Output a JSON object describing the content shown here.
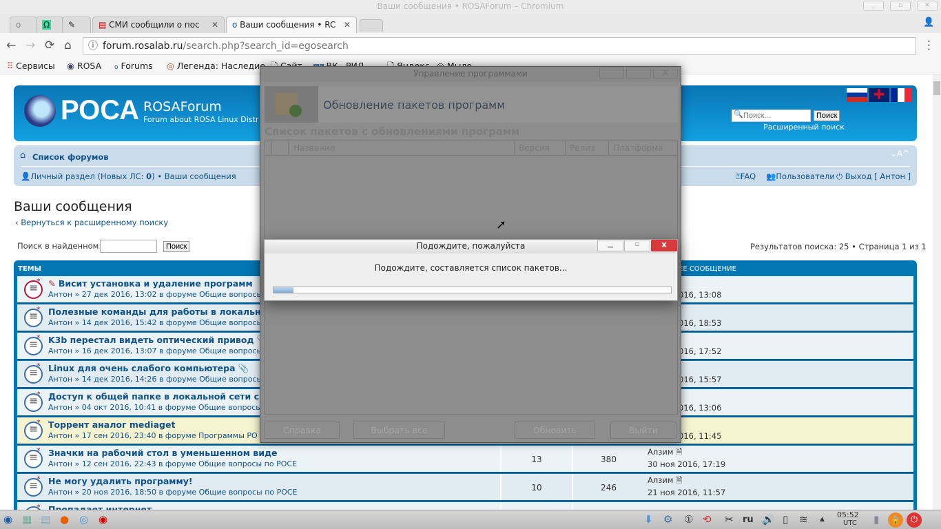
{
  "window": {
    "title": "Ваши сообщения • ROSAForum – Chromium"
  },
  "tabs": [
    {
      "label": "o"
    },
    {
      "label": ""
    },
    {
      "label": ""
    },
    {
      "label": "СМИ сообщили о пос"
    },
    {
      "label": "Ваши сообщения • RC",
      "active": true
    }
  ],
  "address": {
    "host": "forum.rosalab.ru",
    "path": "/search.php?search_id=egosearch"
  },
  "bookmarks": [
    "Сервисы",
    "ROSA",
    "Forums",
    "Легенда: Наследие",
    "Сайт",
    "ВК",
    "РИД",
    "Яндекс",
    "Мыло"
  ],
  "forum": {
    "logo_text": "РОСА",
    "site_name": "ROSAForum",
    "site_desc": "Forum about ROSA Linux Distr",
    "search_placeholder": "Поиск...",
    "search_button": "Поиск",
    "advanced_search": "Расширенный поиск",
    "breadcrumb": "Список форумов",
    "font_size_ctrl": "⌄A^",
    "personal": "Личный раздел (Новых ЛС: ",
    "new_pm": "0",
    "personal_end": ")",
    "sep": " • ",
    "your_posts": "Ваши сообщения",
    "faq": "FAQ",
    "users": "Пользователи",
    "logout": "Выход [ Антон ]",
    "page_title": "Ваши сообщения",
    "back_link": "Вернуться к расширенному поиску",
    "search_in_found": "Поиск в найденном:",
    "search_in_found_button": "Поиск",
    "results": "Результатов поиска: 25 • Страница 1 из 1",
    "col_topics": "ТЕМЫ",
    "col_last": "ЕЕ СООБЩЕНИЕ",
    "rows": [
      {
        "title": "Висит установка и удаление программ",
        "meta": "Антон » 27 дек 2016, 13:02 в форуме Общие вопросы",
        "last": "016, 13:08",
        "hot": true
      },
      {
        "title": "Полезные команды для работы в локальной сет",
        "meta": "Антон » 14 дек 2016, 15:42 в форуме Общие вопросы",
        "last": "016, 18:53"
      },
      {
        "title": "K3b перестал видеть оптический привод",
        "meta": "Антон » 16 дек 2016, 13:07 в форуме Общие вопросы",
        "last": "016, 17:52",
        "attach": true
      },
      {
        "title": "Linux для очень слабого компьютера",
        "meta": "Антон » 14 дек 2016, 14:26 в форуме Общие вопросы",
        "last": "016, 15:57",
        "attach": true
      },
      {
        "title": "Доступ к общей папке в локальной сети с домен",
        "meta": "Антон » 04 окт 2016, 10:41 в форуме Общие вопросы",
        "last": "016, 13:06"
      },
      {
        "title": "Торрент аналог mediaget",
        "meta": "Антон » 17 сен 2016, 23:40 в форуме Программы РО",
        "last": "016, 11:45",
        "highlight": true
      },
      {
        "title": "Значки на рабочий стол в уменьшенном виде",
        "meta": "Антон » 12 сен 2016, 22:43 в форуме Общие вопросы по РОСЕ",
        "replies": "13",
        "views": "380",
        "last_author": "Алзим",
        "last": "30 ноя 2016, 17:19"
      },
      {
        "title": "Не могу удалить программу!",
        "meta": "Антон » 20 ноя 2016, 18:50 в форуме Общие вопросы по РОСЕ",
        "replies": "10",
        "views": "246",
        "last_author": "Алзим",
        "last": "21 ноя 2016, 11:57"
      },
      {
        "title": "Пропадает интернет",
        "meta": "",
        "last": ""
      }
    ]
  },
  "app": {
    "title": "Управление программами",
    "header": "Обновление пакетов программ",
    "section": "Список пакетов с обновлениями программ",
    "columns": [
      "Название",
      "Версия",
      "Релиз",
      "Платформа"
    ],
    "buttons": [
      "Справка",
      "Выбрать все",
      "Обновить",
      "Выйти"
    ]
  },
  "wait": {
    "title": "Подождите, пожалуйста",
    "message": "Подождите, составляется список пакетов...",
    "progress_percent": 5
  },
  "tray": {
    "lang": "ru",
    "time": "05:52",
    "tz": "UTC"
  }
}
